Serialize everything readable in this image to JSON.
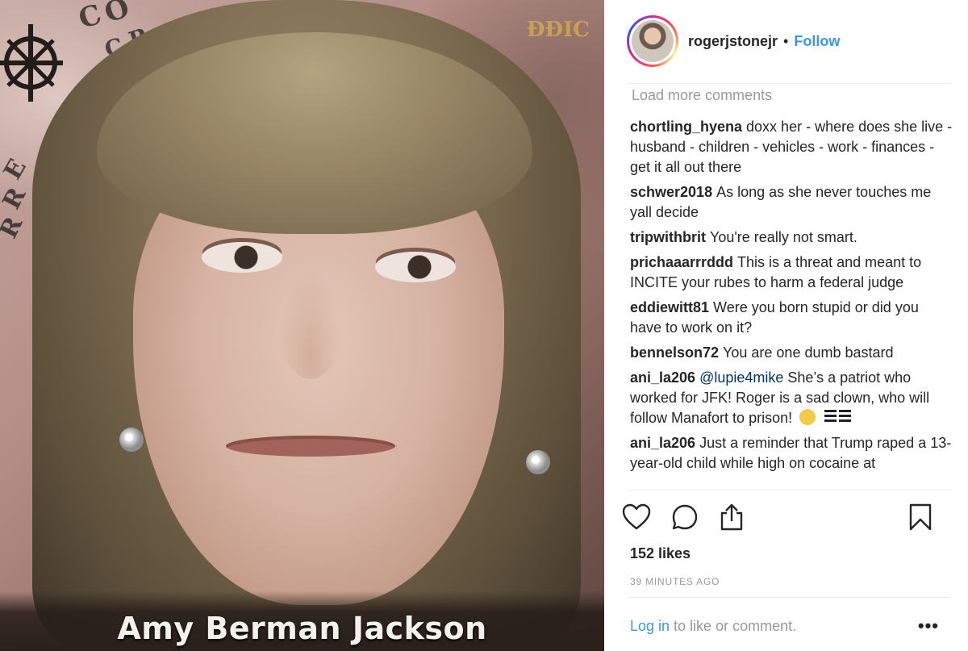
{
  "photo": {
    "caption": "Amy Berman Jackson",
    "watermark": "ĐĐIC",
    "crest_letters": [
      "C",
      "O",
      "C",
      "R",
      "E",
      "R",
      "R"
    ]
  },
  "post": {
    "username": "rogerjstonejr",
    "separator": "•",
    "follow_label": "Follow",
    "load_more_label": "Load more comments",
    "comments": [
      {
        "user": "chortling_hyena",
        "mention": "",
        "text": "doxx her - where does she live - husband - children - vehicles - work - finances - get it all out there"
      },
      {
        "user": "schwer2018",
        "mention": "",
        "text": "As long as she never touches me yall decide"
      },
      {
        "user": "tripwithbrit",
        "mention": "",
        "text": "You're really not smart."
      },
      {
        "user": "prichaaarrrddd",
        "mention": "",
        "text": "This is a threat and meant to INCITE your rubes to harm a federal judge"
      },
      {
        "user": "eddiewitt81",
        "mention": "",
        "text": "Were you born stupid or did you have to work on it?"
      },
      {
        "user": "bennelson72",
        "mention": "",
        "text": "You are one dumb bastard"
      },
      {
        "user": "ani_la206",
        "mention": "@lupie4mike",
        "text": "She’s a patriot who worked for JFK! Roger is a sad clown, who will follow Manafort to prison!"
      },
      {
        "user": "ani_la206",
        "mention": "",
        "text": "Just a reminder that Trump raped a 13-year-old child while high on cocaine at"
      }
    ],
    "likes": "152 likes",
    "time": "39 MINUTES AGO",
    "login_link": "Log in",
    "login_suffix": " to like or comment.",
    "more_label": "•••"
  },
  "icons": {
    "like": "heart-icon",
    "comment": "comment-bubble-icon",
    "share": "share-icon",
    "save": "bookmark-icon",
    "emoji_laugh": "laughing-emoji-icon",
    "emoji_bars": "flag-bars-icon"
  },
  "colors": {
    "link": "#3897f0",
    "text": "#262626",
    "muted": "#999999"
  }
}
